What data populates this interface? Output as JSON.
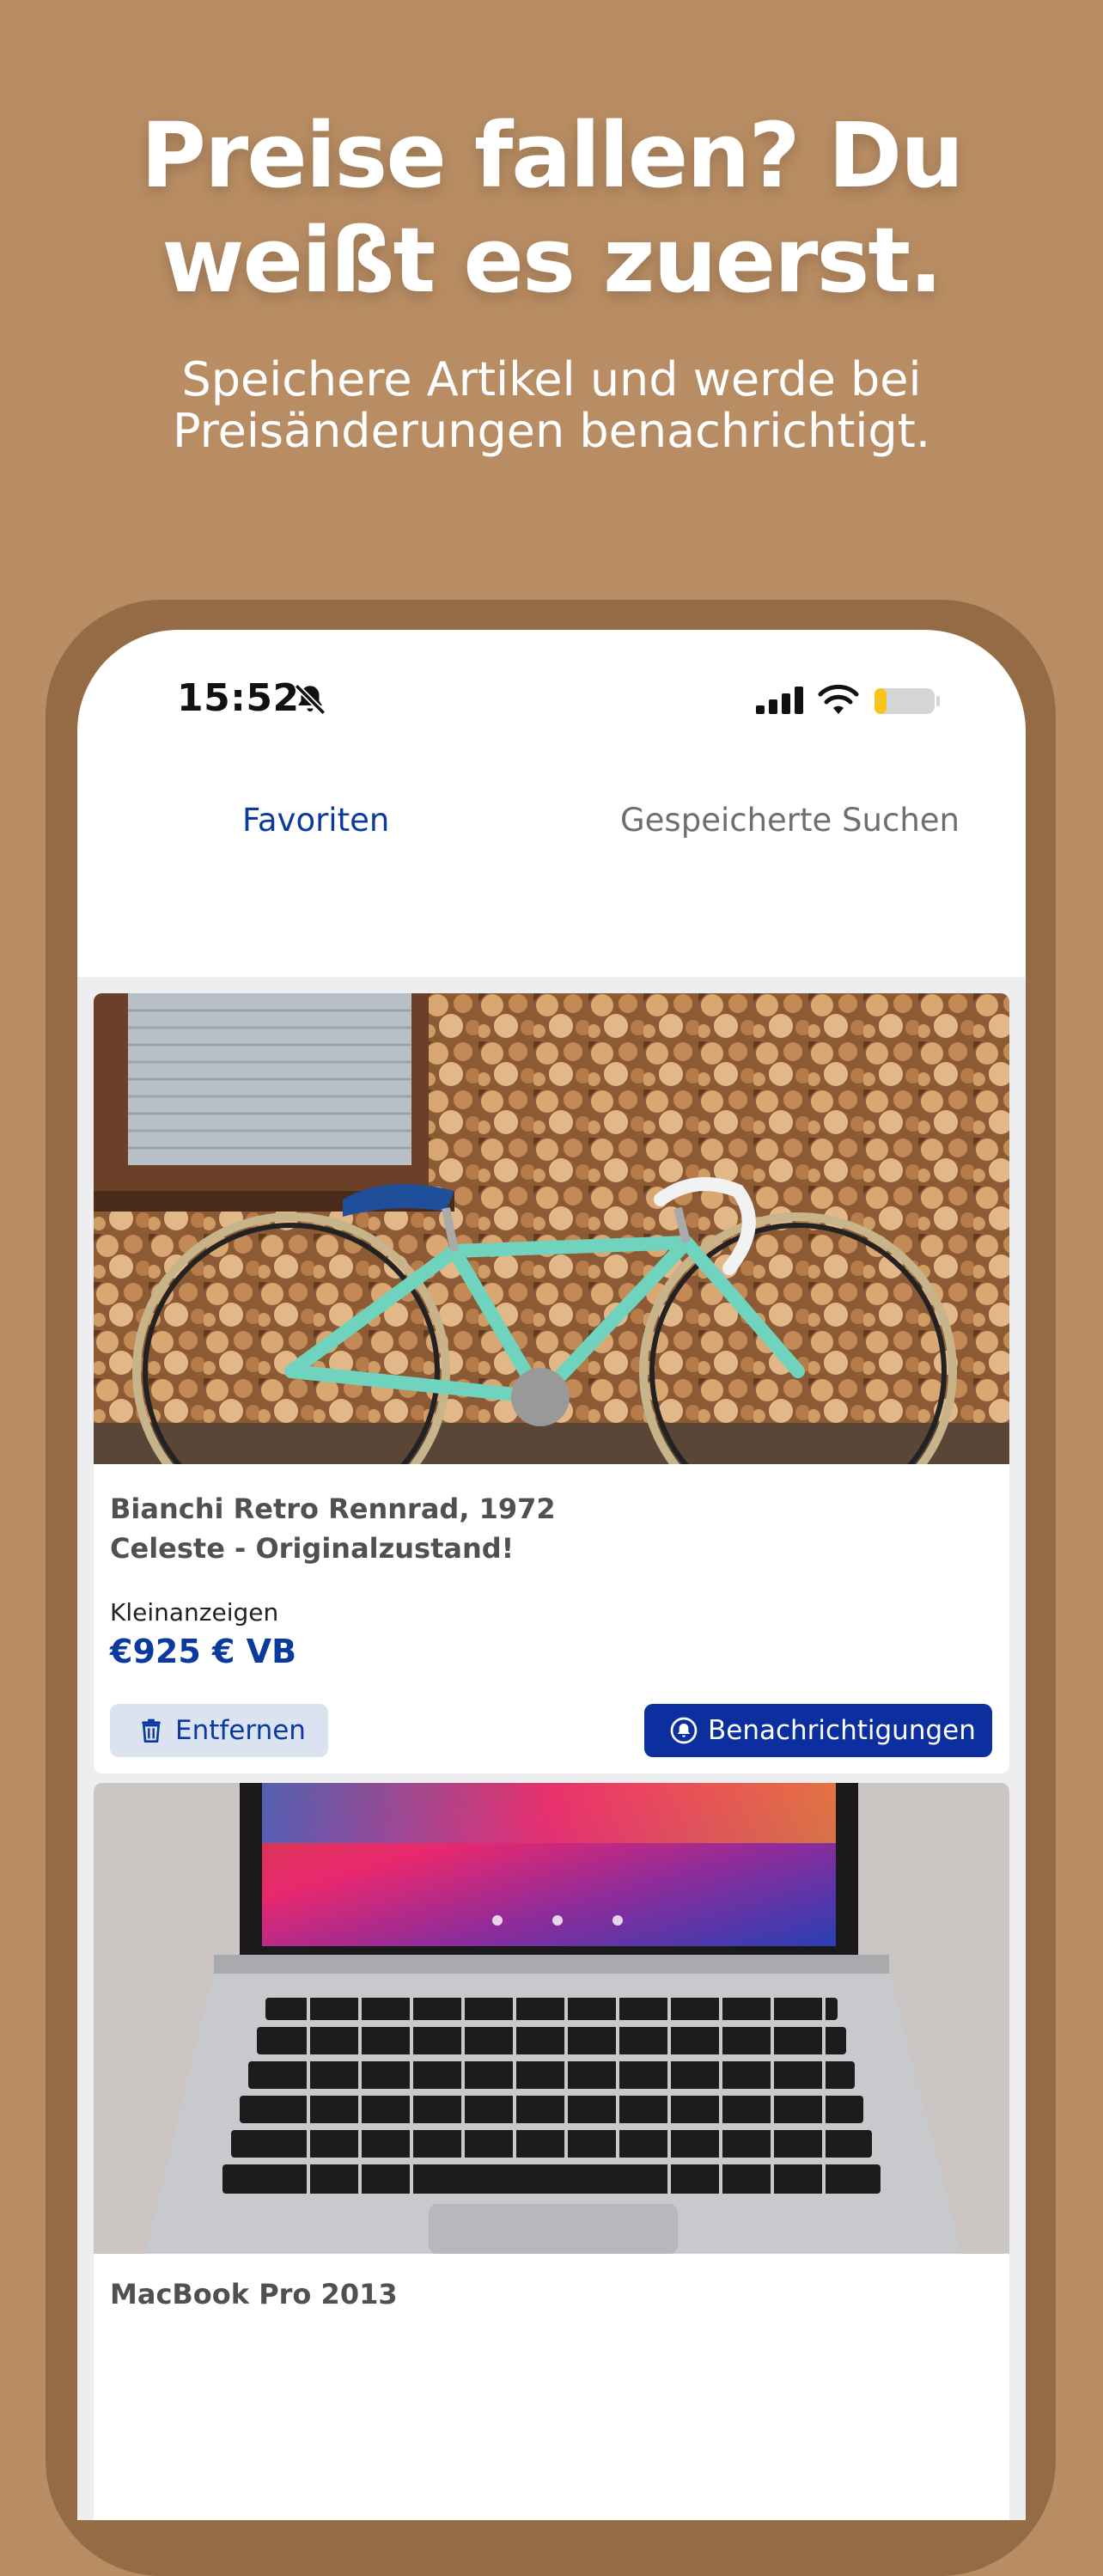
{
  "promo": {
    "headline_line1": "Preise fallen? Du",
    "headline_line2": "weißt es zuerst.",
    "subline_line1": "Speichere Artikel und werde bei",
    "subline_line2": "Preisänderungen benachrichtigt."
  },
  "status_bar": {
    "time": "15:52",
    "icons": [
      "bell-slash-icon",
      "cellular-signal-icon",
      "wifi-icon",
      "battery-icon"
    ]
  },
  "tabs": [
    {
      "label": "Favoriten",
      "active": true
    },
    {
      "label": "Gespeicherte Suchen",
      "active": false
    }
  ],
  "listings": [
    {
      "image": "photo: mint green Bianchi road bike leaning against a stacked firewood wall",
      "title_line1": "Bianchi Retro Rennrad, 1972",
      "title_line2": "Celeste - Originalzustand!",
      "source": "Kleinanzeigen",
      "price": "€925 € VB",
      "remove_label": "Entfernen",
      "notify_label": "Benachrichtigungen"
    },
    {
      "image": "photo: open MacBook Pro with colorful wallpaper and German keyboard",
      "title_line1": "MacBook Pro 2013"
    }
  ],
  "colors": {
    "background": "#B98D63",
    "phone_frame": "#946B44",
    "accent_blue": "#0B3A9E",
    "button_blue": "#0B2F9F",
    "remove_button_bg": "#DBE3F0",
    "list_bg": "#EEEEF0"
  }
}
